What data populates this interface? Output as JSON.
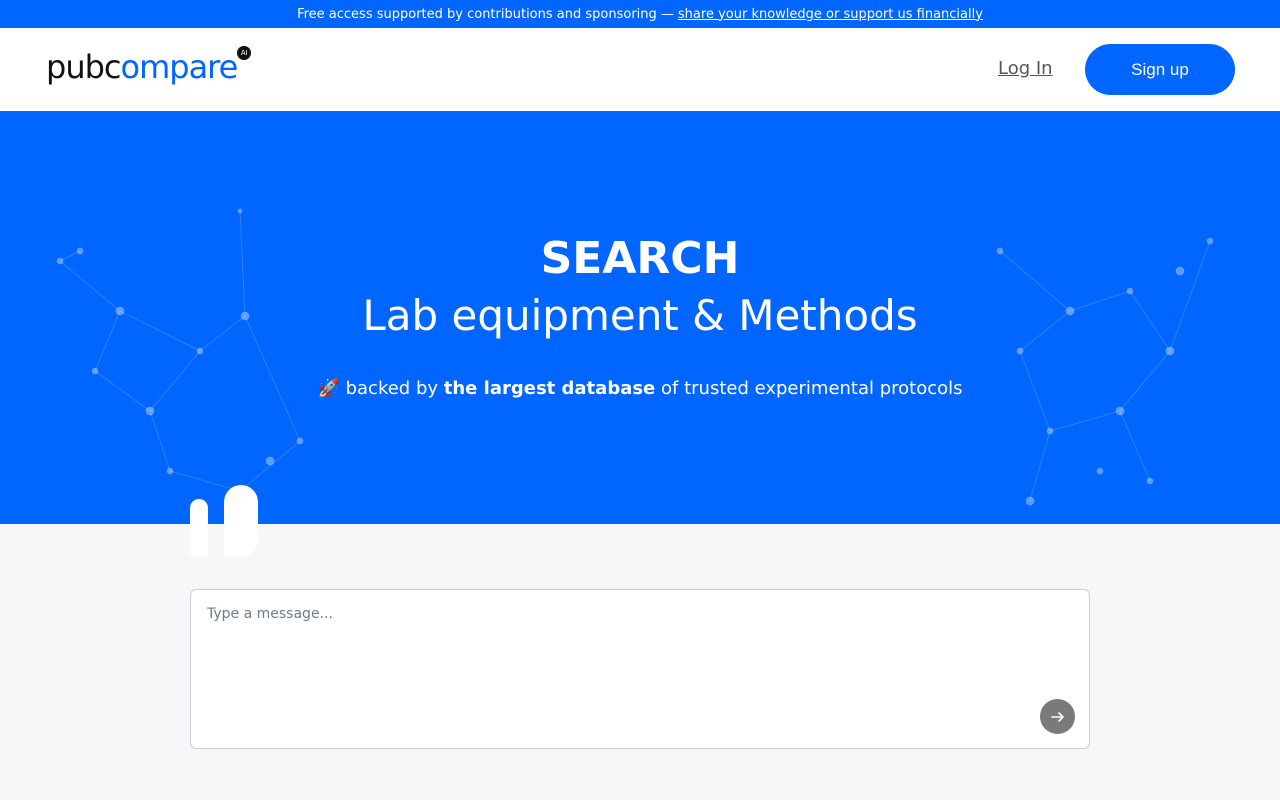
{
  "banner": {
    "text": "Free access supported by contributions and sponsoring —",
    "link": "share your knowledge or support us financially"
  },
  "header": {
    "logo_part1": "pubc",
    "logo_part2": "ompare",
    "logo_badge": "AI",
    "login": "Log In",
    "signup": "Sign up"
  },
  "hero": {
    "title": "SEARCH",
    "subtitle": "Lab equipment & Methods",
    "tag_emoji": "🚀",
    "tag_before": "backed by",
    "tag_bold": "the largest database",
    "tag_after": "of trusted experimental protocols"
  },
  "chat": {
    "placeholder": "Type a message..."
  },
  "colors": {
    "brand": "#0066ff",
    "send_button": "#7a7a7a"
  },
  "icons": {
    "send": "arrow-right-icon",
    "quote": "quote-icon"
  }
}
